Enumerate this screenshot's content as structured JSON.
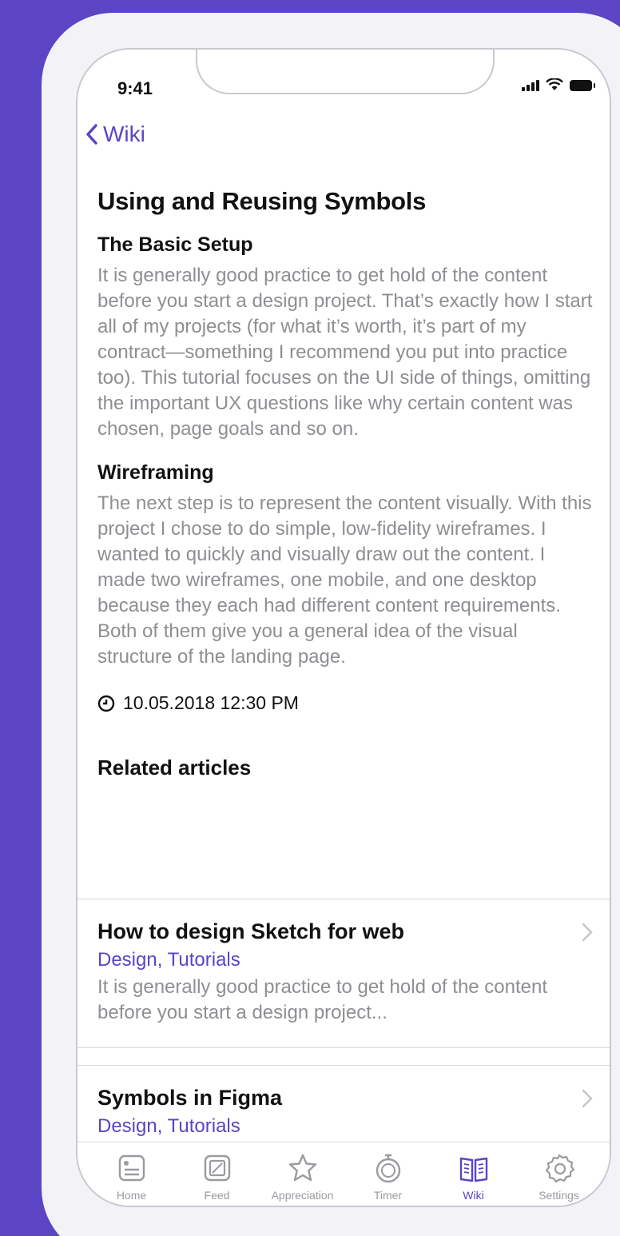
{
  "status_bar": {
    "time": "9:41"
  },
  "nav": {
    "back_label": "Wiki"
  },
  "article": {
    "title": "Using and Reusing Symbols",
    "sections": [
      {
        "heading": "The Basic Setup",
        "body": "It is generally good practice to get hold of the content before you start a design project. That’s exactly how I start all of my projects (for what it’s worth, it’s part of my contract—something I recommend you put into practice too). This tutorial focuses on the UI side of things, omitting the important UX questions like why certain content was chosen, page goals and so on."
      },
      {
        "heading": "Wireframing",
        "body": "The next step is to represent the content visually. With this project I chose to do simple, low-fidelity wireframes. I wanted to quickly and visually draw out the content. I made two wireframes, one mobile, and one desktop because they each had different content requirements. Both of them give you a general idea of the visual structure of the landing page."
      }
    ],
    "date": "10.05.2018 12:30 PM"
  },
  "related": {
    "heading": "Related articles",
    "items": [
      {
        "title": "How to design Sketch for web",
        "tags": "Design, Tutorials",
        "excerpt": "It is generally good practice to get hold of the content before you start a design project..."
      },
      {
        "title": "Symbols in Figma",
        "tags": "Design, Tutorials"
      }
    ]
  },
  "tabbar": {
    "items": [
      {
        "label": "Home",
        "icon": "home-icon"
      },
      {
        "label": "Feed",
        "icon": "feed-icon"
      },
      {
        "label": "Appreciation",
        "icon": "star-icon"
      },
      {
        "label": "Timer",
        "icon": "stopwatch-icon"
      },
      {
        "label": "Wiki",
        "icon": "book-icon",
        "active": true
      },
      {
        "label": "Settings",
        "icon": "gear-icon"
      }
    ]
  },
  "colors": {
    "accent": "#5b45c4",
    "background": "#5b45c4",
    "muted_text": "#8e8e93"
  }
}
